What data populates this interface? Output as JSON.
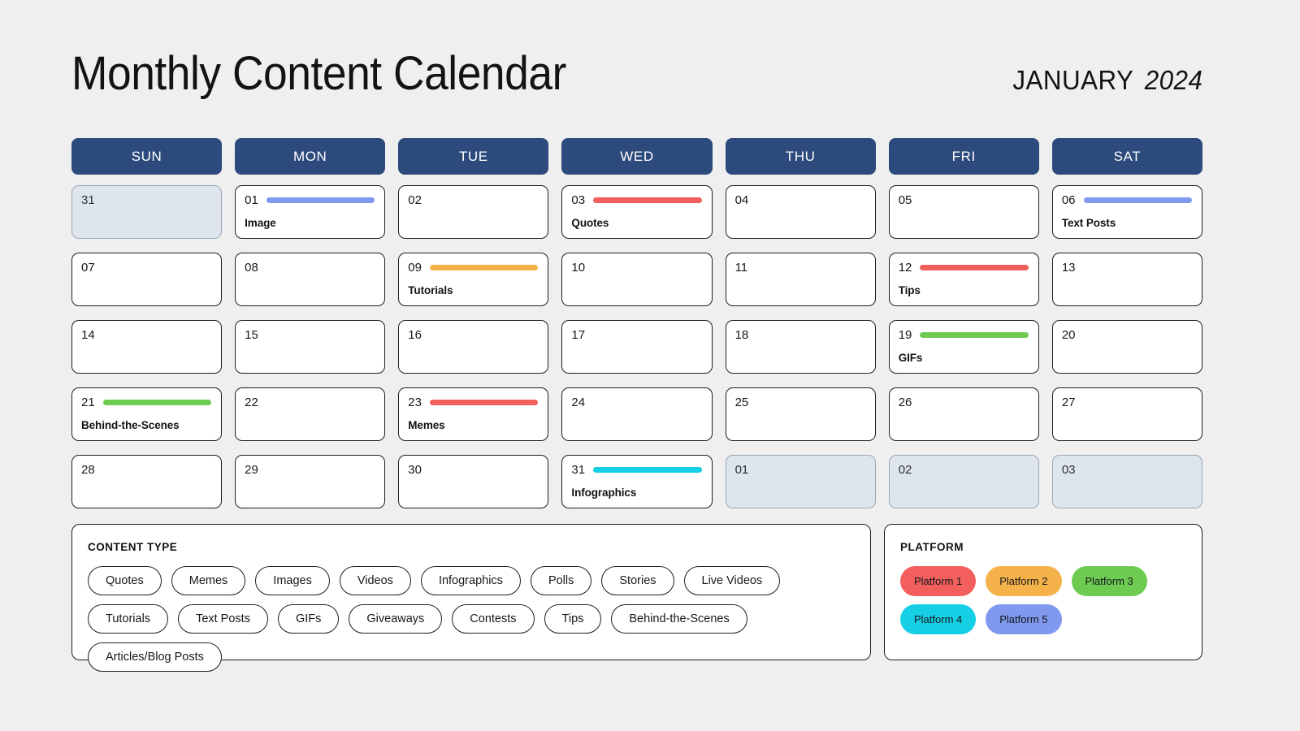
{
  "header": {
    "title": "Monthly Content Calendar",
    "month": "JANUARY",
    "year": "2024"
  },
  "colors": {
    "page_background": "#efefef",
    "day_header": "#2c4a7c",
    "out_of_month_cell": "#dfe5ec",
    "red": "#f25f5c",
    "orange": "#f5b24a",
    "green": "#6ecb52",
    "cyan": "#17cfe4",
    "periwinkle": "#8098ee"
  },
  "weekdays": [
    "SUN",
    "MON",
    "TUE",
    "WED",
    "THU",
    "FRI",
    "SAT"
  ],
  "days": [
    {
      "num": "31",
      "out": true,
      "event": "",
      "color": ""
    },
    {
      "num": "01",
      "out": false,
      "event": "Image",
      "color": "#8098ee"
    },
    {
      "num": "02",
      "out": false,
      "event": "",
      "color": ""
    },
    {
      "num": "03",
      "out": false,
      "event": "Quotes",
      "color": "#f25f5c"
    },
    {
      "num": "04",
      "out": false,
      "event": "",
      "color": ""
    },
    {
      "num": "05",
      "out": false,
      "event": "",
      "color": ""
    },
    {
      "num": "06",
      "out": false,
      "event": "Text Posts",
      "color": "#8098ee"
    },
    {
      "num": "07",
      "out": false,
      "event": "",
      "color": ""
    },
    {
      "num": "08",
      "out": false,
      "event": "",
      "color": ""
    },
    {
      "num": "09",
      "out": false,
      "event": "Tutorials",
      "color": "#f5b24a"
    },
    {
      "num": "10",
      "out": false,
      "event": "",
      "color": ""
    },
    {
      "num": "11",
      "out": false,
      "event": "",
      "color": ""
    },
    {
      "num": "12",
      "out": false,
      "event": "Tips",
      "color": "#f25f5c"
    },
    {
      "num": "13",
      "out": false,
      "event": "",
      "color": ""
    },
    {
      "num": "14",
      "out": false,
      "event": "",
      "color": ""
    },
    {
      "num": "15",
      "out": false,
      "event": "",
      "color": ""
    },
    {
      "num": "16",
      "out": false,
      "event": "",
      "color": ""
    },
    {
      "num": "17",
      "out": false,
      "event": "",
      "color": ""
    },
    {
      "num": "18",
      "out": false,
      "event": "",
      "color": ""
    },
    {
      "num": "19",
      "out": false,
      "event": "GIFs",
      "color": "#6ecb52"
    },
    {
      "num": "20",
      "out": false,
      "event": "",
      "color": ""
    },
    {
      "num": "21",
      "out": false,
      "event": "Behind-the-Scenes",
      "color": "#6ecb52"
    },
    {
      "num": "22",
      "out": false,
      "event": "",
      "color": ""
    },
    {
      "num": "23",
      "out": false,
      "event": "Memes",
      "color": "#f25f5c"
    },
    {
      "num": "24",
      "out": false,
      "event": "",
      "color": ""
    },
    {
      "num": "25",
      "out": false,
      "event": "",
      "color": ""
    },
    {
      "num": "26",
      "out": false,
      "event": "",
      "color": ""
    },
    {
      "num": "27",
      "out": false,
      "event": "",
      "color": ""
    },
    {
      "num": "28",
      "out": false,
      "event": "",
      "color": ""
    },
    {
      "num": "29",
      "out": false,
      "event": "",
      "color": ""
    },
    {
      "num": "30",
      "out": false,
      "event": "",
      "color": ""
    },
    {
      "num": "31",
      "out": false,
      "event": "Infographics",
      "color": "#17cfe4"
    },
    {
      "num": "01",
      "out": true,
      "event": "",
      "color": ""
    },
    {
      "num": "02",
      "out": true,
      "event": "",
      "color": ""
    },
    {
      "num": "03",
      "out": true,
      "event": "",
      "color": ""
    }
  ],
  "content_type_legend": {
    "title": "CONTENT TYPE",
    "items": [
      "Quotes",
      "Memes",
      "Images",
      "Videos",
      "Infographics",
      "Polls",
      "Stories",
      "Live Videos",
      "Tutorials",
      "Text Posts",
      "GIFs",
      "Giveaways",
      "Contests",
      "Tips",
      "Behind-the-Scenes",
      "Articles/Blog Posts"
    ]
  },
  "platform_legend": {
    "title": "PLATFORM",
    "items": [
      {
        "label": "Platform 1",
        "color": "#f25f5c"
      },
      {
        "label": "Platform 2",
        "color": "#f5b24a"
      },
      {
        "label": "Platform 3",
        "color": "#6ecb52"
      },
      {
        "label": "Platform 4",
        "color": "#17cfe4"
      },
      {
        "label": "Platform 5",
        "color": "#8098ee"
      }
    ]
  }
}
